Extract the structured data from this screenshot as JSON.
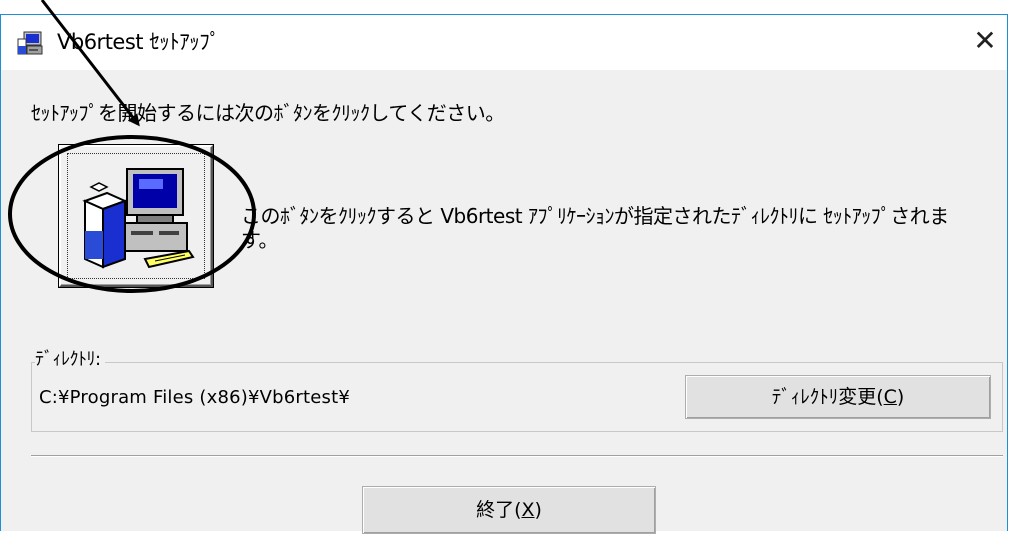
{
  "window": {
    "title": "Vb6rtest ｾｯﾄｱｯﾌﾟ",
    "close_glyph": "✕"
  },
  "instruction_text": "ｾｯﾄｱｯﾌﾟを開始するには次のﾎﾞﾀﾝをｸﾘｯｸしてください。",
  "setup_button": {
    "icon": "installer-computer-icon",
    "description": "このﾎﾞﾀﾝをｸﾘｯｸすると Vb6rtest ｱﾌﾟﾘｹｰｼｮﾝが指定されたﾃﾞｨﾚｸﾄﾘに ｾｯﾄｱｯﾌﾟされます。"
  },
  "directory": {
    "group_label": "ﾃﾞｨﾚｸﾄﾘ:",
    "path": "C:¥Program Files (x86)¥Vb6rtest¥",
    "change_button_label": "ﾃﾞｨﾚｸﾄﾘ変更(",
    "change_button_accel": "C",
    "change_button_suffix": ")"
  },
  "exit_button": {
    "label": "終了(",
    "accel": "X",
    "suffix": ")"
  },
  "colors": {
    "window_border": "#1e8fd6",
    "dialog_bg": "#f0f0f0",
    "button_bg": "#e1e1e1"
  },
  "annotation": {
    "type": "arrow-and-ellipse",
    "target": "setup-button"
  }
}
